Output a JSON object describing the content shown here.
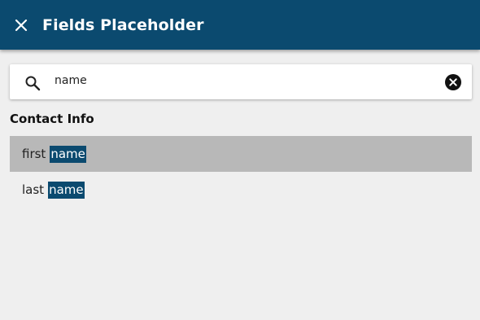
{
  "header": {
    "title": "Fields Placeholder",
    "close_icon": "close-icon"
  },
  "search": {
    "value": "name",
    "search_icon": "search-icon",
    "clear_icon": "clear-circle-icon"
  },
  "section": {
    "title": "Contact Info"
  },
  "results": [
    {
      "prefix": "first",
      "match": "name",
      "selected": true
    },
    {
      "prefix": "last",
      "match": "name",
      "selected": false
    }
  ],
  "colors": {
    "header_bg": "#0b4a6f",
    "highlight_bg": "#0b4a6f",
    "selected_row_bg": "#b8b8b8",
    "page_bg": "#efefef"
  }
}
